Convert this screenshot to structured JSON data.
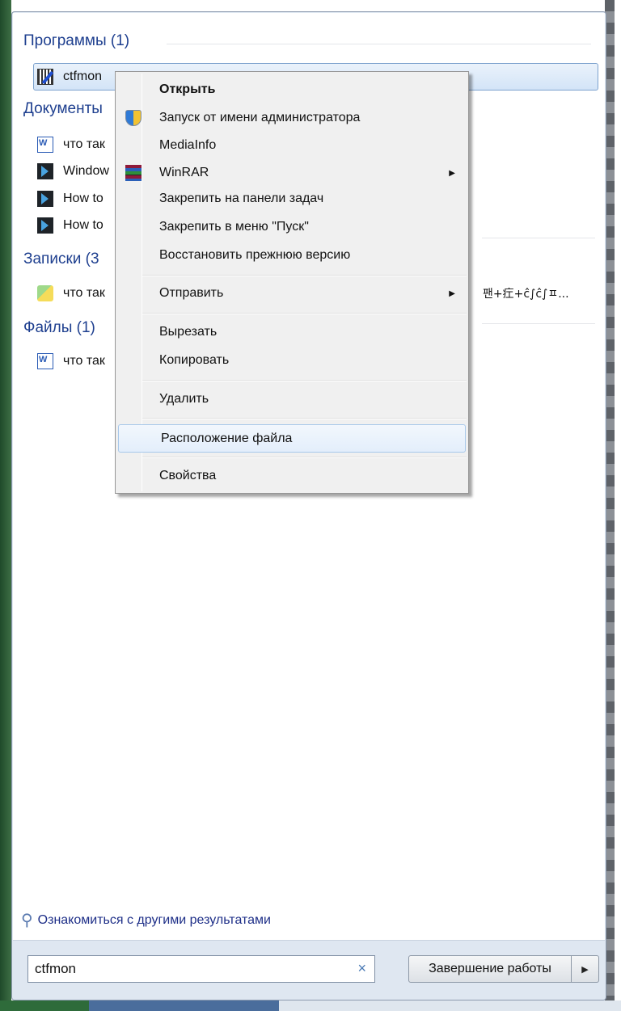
{
  "sections": {
    "programs": {
      "header": "Программы (1)",
      "items": [
        {
          "label": "ctfmon",
          "icon": "notepad-pen-icon"
        }
      ]
    },
    "documents": {
      "header": "Документы",
      "items": [
        {
          "label": "что так",
          "icon": "word-doc-icon"
        },
        {
          "label": "Window",
          "icon": "powershell-icon"
        },
        {
          "label": "How to",
          "icon": "powershell-icon"
        },
        {
          "label": "How to",
          "icon": "powershell-icon"
        }
      ]
    },
    "notes": {
      "header": "Записки (3",
      "items": [
        {
          "label": "что так",
          "icon": "sticky-notes-icon",
          "extra": "팬+疘+ĉ∫ĉ∫ㅍ..."
        }
      ]
    },
    "files": {
      "header": "Файлы (1)",
      "items": [
        {
          "label": "что так",
          "icon": "word-doc-icon"
        }
      ]
    }
  },
  "more_results": "Ознакомиться с другими результатами",
  "search": {
    "value": "ctfmon",
    "clear": "×"
  },
  "shutdown": {
    "label": "Завершение работы",
    "arrow": "▶"
  },
  "context_menu": {
    "items": [
      "Открыть",
      "Запуск от имени администратора",
      "MediaInfo",
      "WinRAR",
      "Закрепить на панели задач",
      "Закрепить в меню \"Пуск\"",
      "Восстановить прежнюю версию",
      "Отправить",
      "Вырезать",
      "Копировать",
      "Удалить",
      "Расположение файла",
      "Свойства"
    ],
    "submenu_arrow": "▶",
    "hovered": "Расположение файла"
  }
}
